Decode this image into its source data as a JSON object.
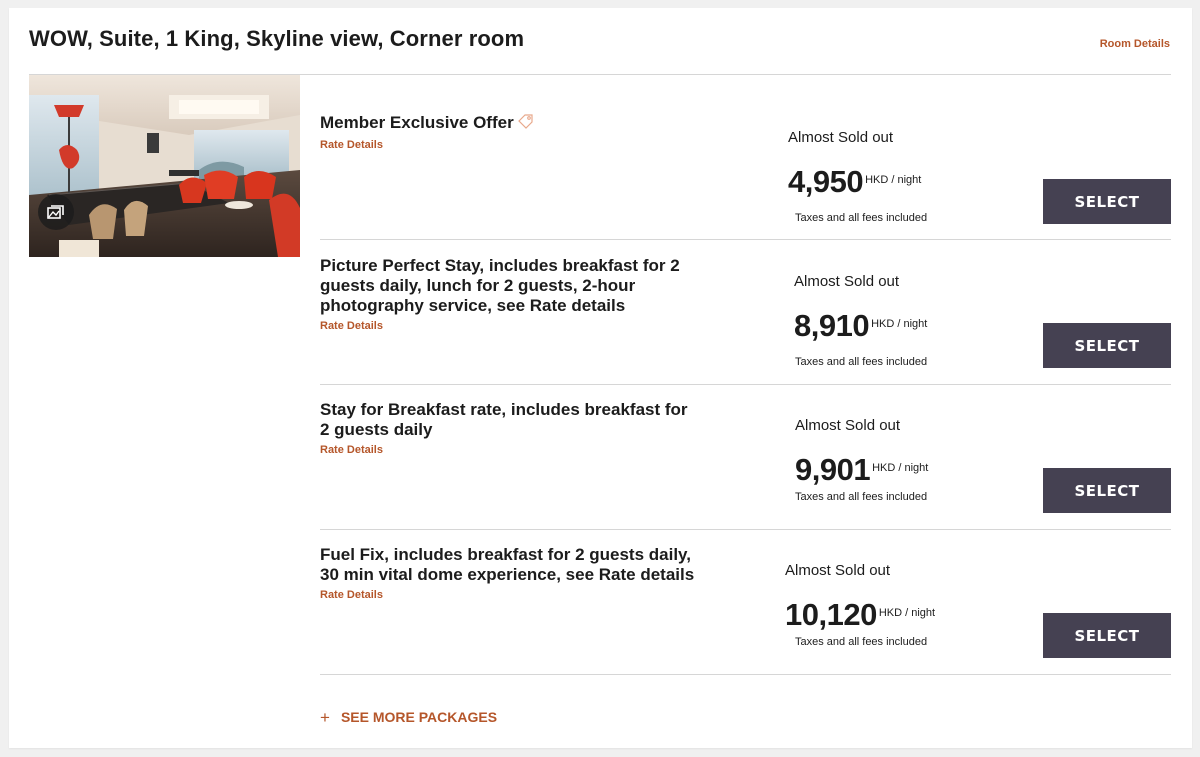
{
  "room": {
    "title": "WOW, Suite, 1 King, Skyline view, Corner room",
    "details_link": "Room Details",
    "photo_icon": "gallery-icon"
  },
  "rates": [
    {
      "name": "Member Exclusive Offer",
      "has_tag_icon": true,
      "details_link": "Rate Details",
      "availability": "Almost Sold out",
      "price": "4,950",
      "unit": "HKD / night",
      "taxes": "Taxes and all fees included",
      "button": "SELECT"
    },
    {
      "name": "Picture Perfect Stay, includes breakfast for 2 guests daily, lunch for 2 guests, 2-hour photography service, see Rate details",
      "has_tag_icon": false,
      "details_link": "Rate Details",
      "availability": "Almost Sold out",
      "price": "8,910",
      "unit": "HKD / night",
      "taxes": "Taxes and all fees included",
      "button": "SELECT"
    },
    {
      "name": "Stay for Breakfast rate, includes breakfast for 2 guests daily",
      "has_tag_icon": false,
      "details_link": "Rate Details",
      "availability": "Almost Sold out",
      "price": "9,901",
      "unit": "HKD / night",
      "taxes": "Taxes and all fees included",
      "button": "SELECT"
    },
    {
      "name": "Fuel Fix, includes breakfast for 2 guests daily, 30 min vital dome experience, see Rate details",
      "has_tag_icon": false,
      "details_link": "Rate Details",
      "availability": "Almost Sold out",
      "price": "10,120",
      "unit": "HKD / night",
      "taxes": "Taxes and all fees included",
      "button": "SELECT"
    }
  ],
  "see_more": {
    "icon": "plus-icon",
    "label": "SEE MORE PACKAGES"
  },
  "colors": {
    "accent": "#b5562a",
    "button": "#454152",
    "divider": "#d6d6d6",
    "text": "#1c1c1c"
  }
}
